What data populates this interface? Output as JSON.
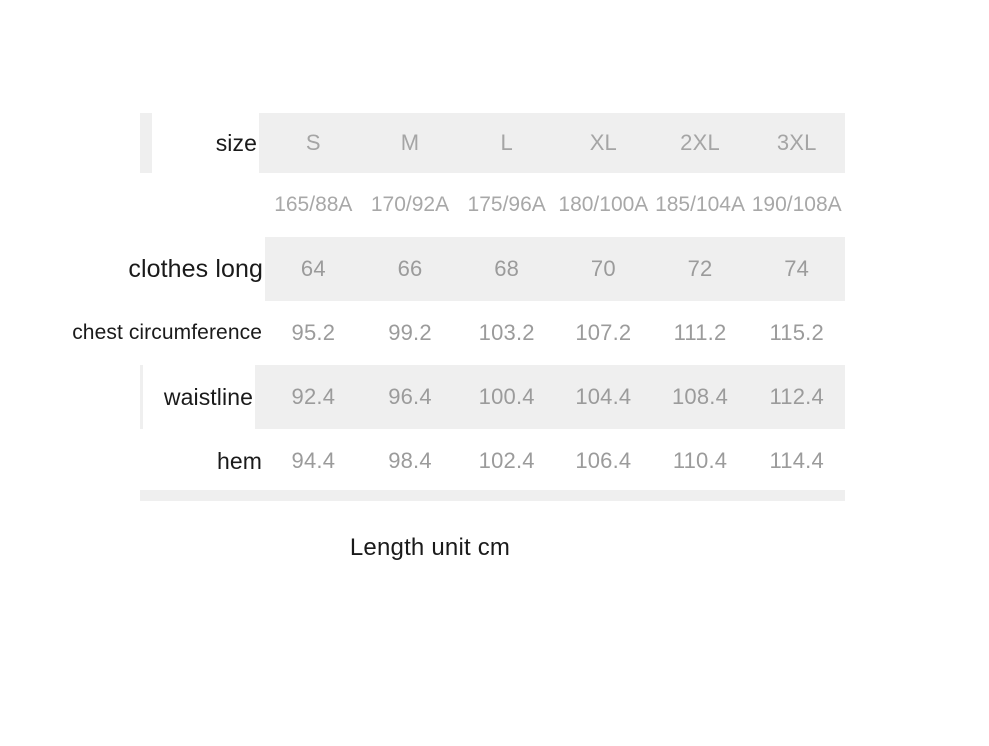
{
  "table": {
    "corner_label": "size",
    "columns": [
      "S",
      "M",
      "L",
      "XL",
      "2XL",
      "3XL"
    ],
    "spec_row": [
      "165/88A",
      "170/92A",
      "175/96A",
      "180/100A",
      "185/104A",
      "190/108A"
    ],
    "rows": [
      {
        "label": "clothes long",
        "values": [
          "64",
          "66",
          "68",
          "70",
          "72",
          "74"
        ]
      },
      {
        "label": "chest circumference",
        "values": [
          "95.2",
          "99.2",
          "103.2",
          "107.2",
          "111.2",
          "115.2"
        ]
      },
      {
        "label": "waistline",
        "values": [
          "92.4",
          "96.4",
          "100.4",
          "104.4",
          "108.4",
          "112.4"
        ]
      },
      {
        "label": "hem",
        "values": [
          "94.4",
          "98.4",
          "102.4",
          "106.4",
          "110.4",
          "114.4"
        ]
      }
    ]
  },
  "caption": "Length unit cm",
  "colors": {
    "band": "#efefef",
    "value_text": "#9b9b9b",
    "label_text": "#1a1a1a",
    "page_background": "#ffffff"
  },
  "chart_data": {
    "type": "table",
    "title": "Size chart",
    "columns": [
      "size",
      "S",
      "M",
      "L",
      "XL",
      "2XL",
      "3XL"
    ],
    "rows": [
      [
        "",
        "165/88A",
        "170/92A",
        "175/96A",
        "180/100A",
        "185/104A",
        "190/108A"
      ],
      [
        "clothes long",
        "64",
        "66",
        "68",
        "70",
        "72",
        "74"
      ],
      [
        "chest circumference",
        "95.2",
        "99.2",
        "103.2",
        "107.2",
        "111.2",
        "115.2"
      ],
      [
        "waistline",
        "92.4",
        "96.4",
        "100.4",
        "104.4",
        "108.4",
        "112.4"
      ],
      [
        "hem",
        "94.4",
        "98.4",
        "102.4",
        "106.4",
        "110.4",
        "114.4"
      ]
    ],
    "units": "cm",
    "annotations": [
      "Length unit cm"
    ]
  }
}
